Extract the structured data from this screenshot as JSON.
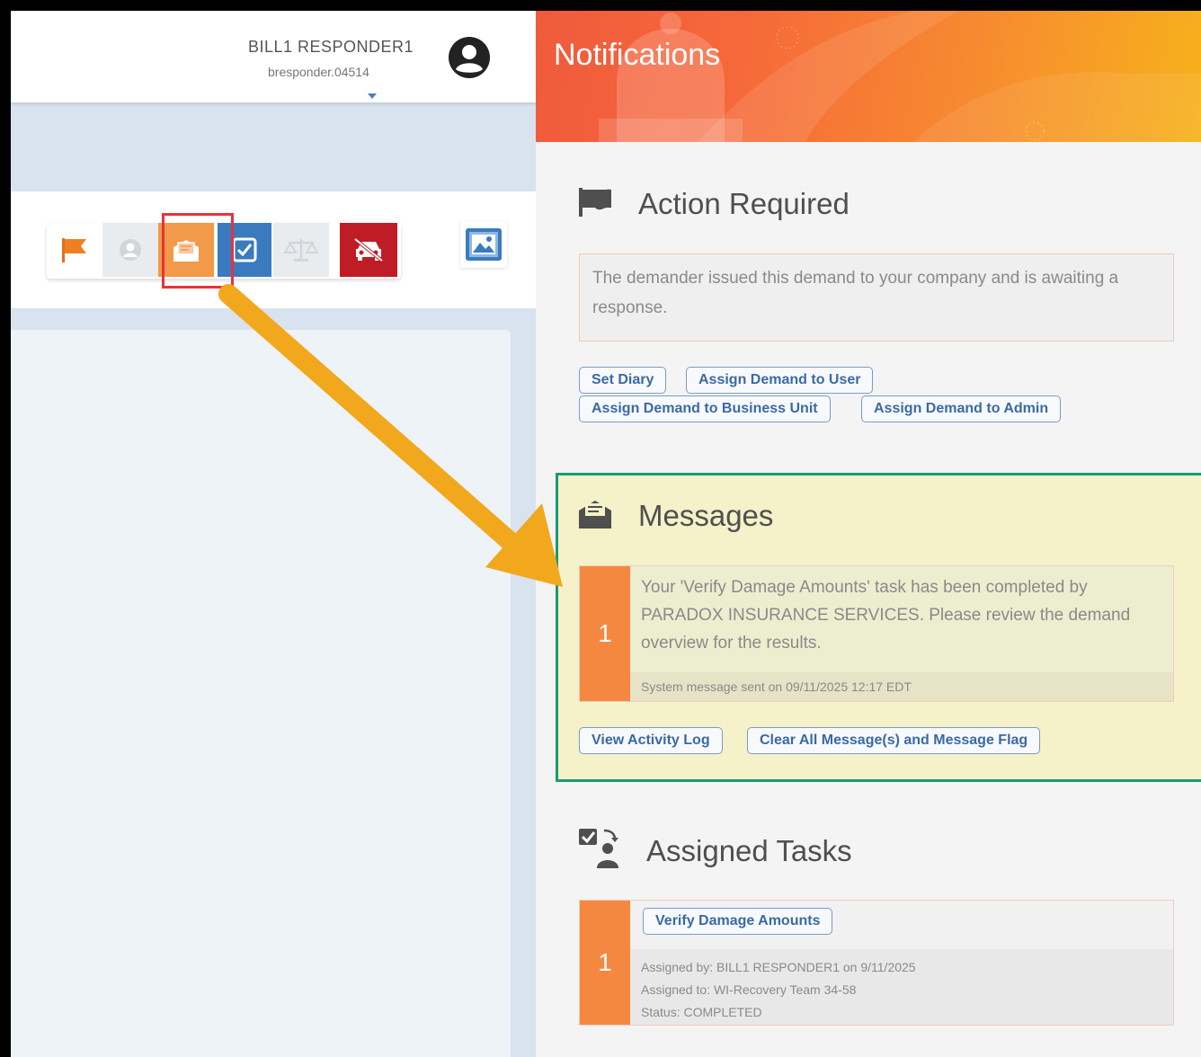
{
  "user": {
    "name": "BILL1 RESPONDER1",
    "id": "bresponder.04514"
  },
  "toolbar_icons": [
    "flag-icon",
    "person-icon",
    "message-icon",
    "task-checkbox-icon",
    "scale-icon",
    "car-crash-icon",
    "photo-icon"
  ],
  "notifications": {
    "title": "Notifications",
    "action_required": {
      "heading": "Action Required",
      "description": "The demander issued this demand to your company and is awaiting a response.",
      "buttons": {
        "set_diary": "Set Diary",
        "assign_user": "Assign Demand to User",
        "assign_business_unit": "Assign Demand to Business Unit",
        "assign_admin": "Assign Demand to Admin"
      }
    },
    "messages": {
      "heading": "Messages",
      "count": "1",
      "text": "Your 'Verify Damage Amounts' task has been completed by PARADOX INSURANCE SERVICES. Please review the demand overview for the results.",
      "meta": "System message sent on 09/11/2025 12:17 EDT",
      "buttons": {
        "view_log": "View Activity Log",
        "clear_all": "Clear All Message(s) and Message Flag"
      }
    },
    "assigned_tasks": {
      "heading": "Assigned Tasks",
      "count": "1",
      "task_button": "Verify Damage Amounts",
      "assigned_by": "Assigned by: BILL1 RESPONDER1 on 9/11/2025",
      "assigned_to": "Assigned to: WI-Recovery Team 34-58",
      "status": "Status: COMPLETED"
    }
  },
  "colors": {
    "orange": "#f58840",
    "blue": "#3a7bbf",
    "red": "#c01c26",
    "highlight_green": "#1a9a77",
    "highlight_yellow": "#f5f1c8",
    "arrow": "#f2a81c"
  }
}
